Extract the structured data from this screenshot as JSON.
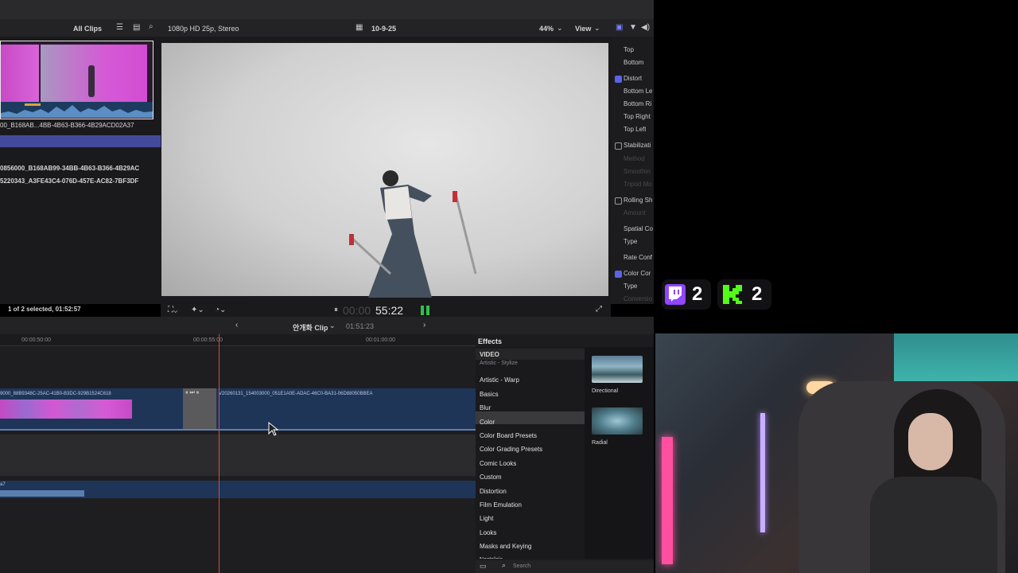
{
  "browser": {
    "filter_label": "All Clips",
    "clip_name_1": "00_B168AB...4BB-4B63-B366-4B29ACD02A37",
    "clip_name_2": "0856000_B168AB99-34BB-4B63-B366-4B29AC",
    "clip_name_3": "5220343_A3FE43C4-076D-457E-AC82-7BF3DF",
    "selection_status": "1 of 2 selected, 01:52:57"
  },
  "viewer": {
    "format_label": "1080p HD 25p, Stereo",
    "project_name": "10-9-25",
    "zoom_label": "44%",
    "view_label": "View",
    "timecode_dim": "00:00",
    "timecode": "55:22"
  },
  "inspector": {
    "rows": [
      {
        "label": "Top",
        "checkbox": "none",
        "faded": false
      },
      {
        "label": "Bottom",
        "checkbox": "none",
        "faded": false
      },
      {
        "label": "Distort",
        "checkbox": "on",
        "faded": false
      },
      {
        "label": "Bottom Le",
        "checkbox": "none",
        "faded": false
      },
      {
        "label": "Bottom Ri",
        "checkbox": "none",
        "faded": false
      },
      {
        "label": "Top Right",
        "checkbox": "none",
        "faded": false
      },
      {
        "label": "Top Left",
        "checkbox": "none",
        "faded": false
      },
      {
        "label": "Stabilizati",
        "checkbox": "off",
        "faded": false
      },
      {
        "label": "Method",
        "checkbox": "none",
        "faded": true
      },
      {
        "label": "Smoothin",
        "checkbox": "none",
        "faded": true
      },
      {
        "label": "Tripod Mo",
        "checkbox": "none",
        "faded": true
      },
      {
        "label": "Rolling Sh",
        "checkbox": "off",
        "faded": false
      },
      {
        "label": "Amount",
        "checkbox": "none",
        "faded": true
      },
      {
        "label": "Spatial Co",
        "checkbox": "none",
        "faded": false
      },
      {
        "label": "Type",
        "checkbox": "none",
        "faded": false
      },
      {
        "label": "Rate Conf",
        "checkbox": "none",
        "faded": false
      },
      {
        "label": "Color Cor",
        "checkbox": "on",
        "faded": false
      },
      {
        "label": "Type",
        "checkbox": "none",
        "faded": false
      },
      {
        "label": "Conversio",
        "checkbox": "none",
        "faded": true
      }
    ]
  },
  "timeline": {
    "clip_title": "안개화 Clip",
    "duration": "01:51:23",
    "ruler_1": "00:00:50:00",
    "ruler_2": "00:00:55:00",
    "ruler_3": "00:01:00:00",
    "clip_a_name": "9000_88B9348C-25AC-41B0-B3DC-929B1524C618",
    "clip_b_name": "V20260131_154003000_051E1A0E-ADAC-46C0-BA31-06D88050BBEA",
    "audio_label": "a7"
  },
  "effects": {
    "title": "Effects",
    "category": "VIDEO",
    "items": [
      "Artistic - Stylize",
      "Artistic - Warp",
      "Basics",
      "Blur",
      "Color",
      "Color Board Presets",
      "Color Grading Presets",
      "Comic Looks",
      "Custom",
      "Distortion",
      "Film Emulation",
      "Light",
      "Looks",
      "Masks and Keying",
      "Nostalgia"
    ],
    "selected_index": 3,
    "thumbs": [
      {
        "label": "Directional"
      },
      {
        "label": "Radial"
      }
    ],
    "search_placeholder": "Search"
  },
  "overlay": {
    "twitch_count": "2",
    "kick_count": "2",
    "twitch_color": "#9146ff",
    "kick_color": "#53fc18"
  }
}
